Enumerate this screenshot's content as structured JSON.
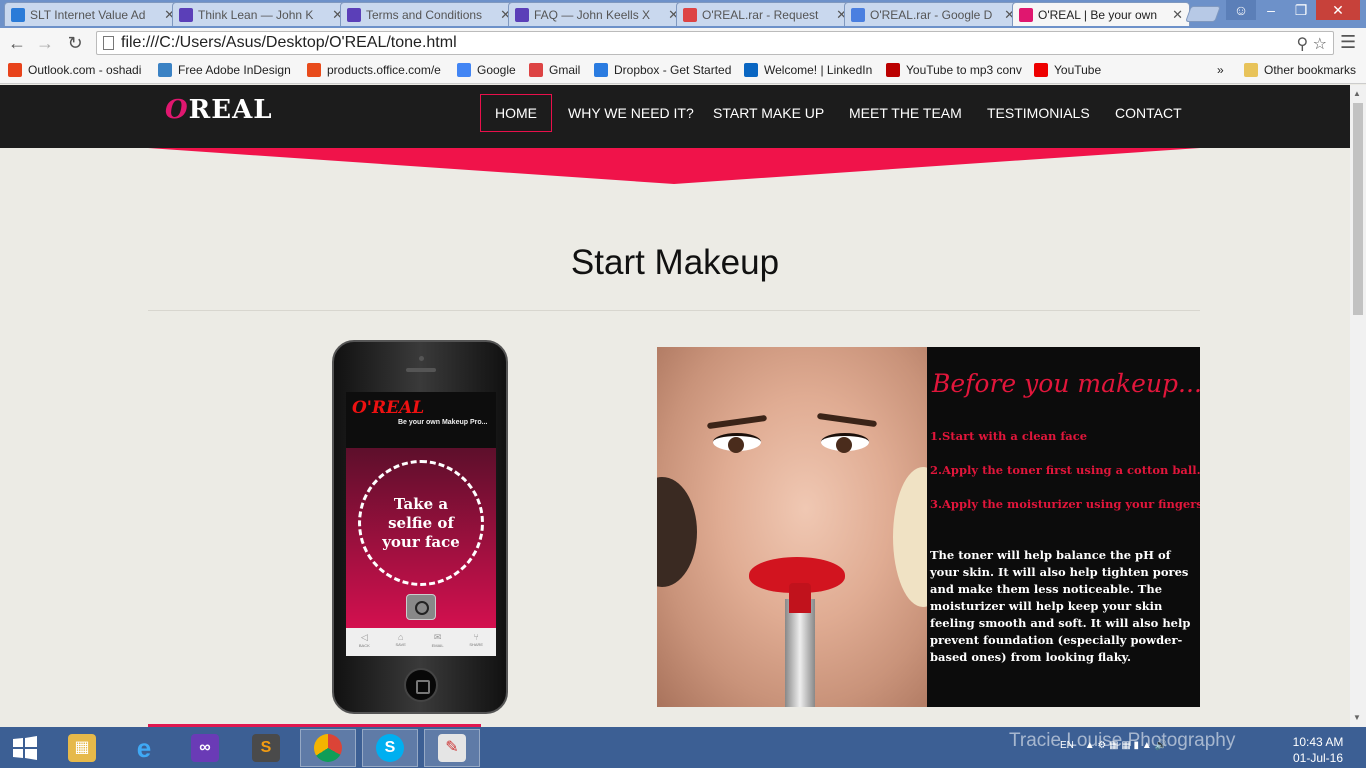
{
  "browser": {
    "tabs": [
      {
        "label": "SLT Internet Value Ad",
        "icon": "slt-icon",
        "color": "#2a7bd8"
      },
      {
        "label": "Think Lean — John K",
        "icon": "x-icon",
        "color": "#5b3fb8"
      },
      {
        "label": "Terms and Conditions",
        "icon": "x-icon",
        "color": "#5b3fb8"
      },
      {
        "label": "FAQ — John Keells X",
        "icon": "x-icon",
        "color": "#5b3fb8"
      },
      {
        "label": "O'REAL.rar - Request",
        "icon": "gmail-icon",
        "color": "#d44"
      },
      {
        "label": "O'REAL.rar - Google D",
        "icon": "docs-icon",
        "color": "#4a7fe0"
      },
      {
        "label": "O'REAL | Be your own",
        "icon": "oreal-icon",
        "color": "#e0176f"
      }
    ],
    "url": "file:///C:/Users/Asus/Desktop/O'REAL/tone.html",
    "bookmarks": [
      {
        "label": "Outlook.com - oshadi",
        "color": "#e8431b"
      },
      {
        "label": "Free Adobe InDesign",
        "color": "#3b82c4"
      },
      {
        "label": "products.office.com/e",
        "color": "#e84b1b"
      },
      {
        "label": "Google",
        "color": "#4285f4"
      },
      {
        "label": "Gmail",
        "color": "#d44"
      },
      {
        "label": "Dropbox - Get Started",
        "color": "#2a7be0"
      },
      {
        "label": "Welcome! | LinkedIn",
        "color": "#0a66c2"
      },
      {
        "label": "YouTube to mp3 conv",
        "color": "#b00"
      },
      {
        "label": "YouTube",
        "color": "#e00"
      }
    ],
    "other_bookmarks": "Other bookmarks"
  },
  "site": {
    "logo_o": "O",
    "logo_rest": "REAL",
    "nav": [
      "HOME",
      "WHY WE NEED IT?",
      "START MAKE UP",
      "MEET THE TEAM",
      "TESTIMONIALS",
      "CONTACT"
    ],
    "active_nav": "HOME",
    "section_title": "Start Makeup",
    "phone": {
      "app_logo": "O'REAL",
      "app_tagline": "Be your own Makeup Pro...",
      "selfie_text": "Take a selfie of your face",
      "footer": [
        "BACK",
        "SAVE",
        "EMAIL",
        "SHARE"
      ]
    },
    "tips": {
      "heading": "Before you makeup...",
      "steps": [
        "1.Start with a clean face",
        "2.Apply the toner first using a cotton ball.",
        "3.Apply the moisturizer using your fingers."
      ],
      "paragraph": "The toner will help balance the pH of your skin. It will also help tighten pores and make them less noticeable. The moisturizer will help keep your skin feeling smooth and soft. It will also help prevent foundation (especially powder-based ones) from looking flaky."
    },
    "accent_color": "#e8104b"
  },
  "taskbar": {
    "watermark": "Tracie Louise Photography",
    "lang": "EN",
    "time": "10:43 AM",
    "date": "01-Jul-16"
  }
}
